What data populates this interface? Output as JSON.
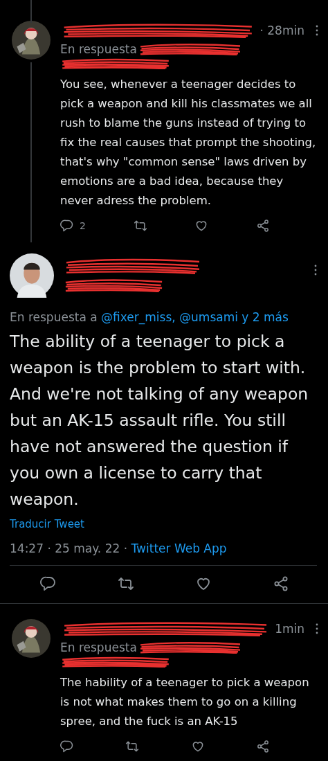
{
  "thread": [
    {
      "kind": "reply",
      "time": "· 28min",
      "reply_prefix": "En respuesta",
      "text": "You see, whenever a teenager decides to pick a weapon and kill his classmates we all rush to blame the guns instead of trying to fix the real causes that prompt the shooting, that's why \"common sense\" laws driven by emotions are a bad idea, because they never adress the problem.",
      "reply_count": "2",
      "thread_line": true
    },
    {
      "kind": "focus",
      "reply_prefix": "En respuesta a",
      "reply_to": "@fixer_miss, @umsami y 2 más",
      "text": "The ability of a teenager to pick a weapon is the problem to start with. And we're not talking of any weapon but an AK-15 assault rifle. You still have not answered the question if you own a license to carry that weapon.",
      "translate": "Traducir Tweet",
      "timestamp": "14:27 · 25 may. 22 ·",
      "source": "Twitter Web App"
    },
    {
      "kind": "reply",
      "time": "1min",
      "reply_prefix": "En respuesta",
      "text": "The hability of a teenager to pick a weapon is not what makes them to go on a killing spree, and the fuck is an AK-15",
      "thread_line": false
    }
  ]
}
